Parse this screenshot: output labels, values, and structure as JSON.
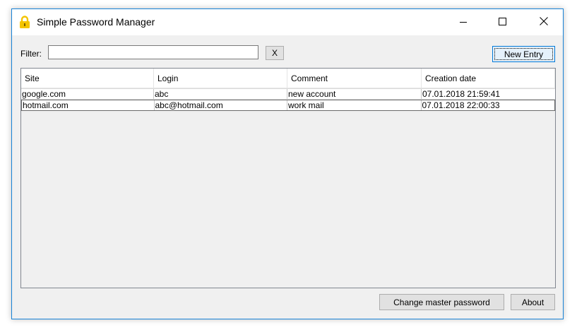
{
  "window": {
    "title": "Simple Password Manager",
    "accent_color": "#1883d7"
  },
  "toolbar": {
    "filter_label": "Filter:",
    "filter_value": "",
    "clear_label": "X",
    "new_entry_label": "New Entry"
  },
  "table": {
    "columns": [
      "Site",
      "Login",
      "Comment",
      "Creation date"
    ],
    "rows": [
      [
        "google.com",
        "abc",
        "new account",
        "07.01.2018 21:59:41"
      ],
      [
        "hotmail.com",
        "abc@hotmail.com",
        "work mail",
        "07.01.2018 22:00:33"
      ]
    ]
  },
  "footer": {
    "change_master_label": "Change master password",
    "about_label": "About"
  },
  "icons": {
    "app": "padlock-icon",
    "minimize": "minimize-icon",
    "maximize": "maximize-icon",
    "close": "close-icon"
  }
}
